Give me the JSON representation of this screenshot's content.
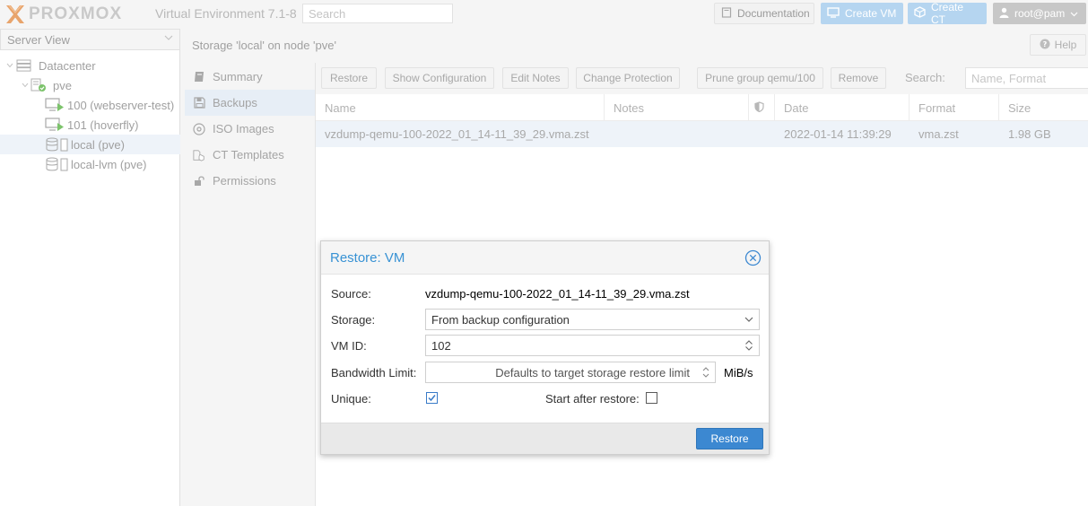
{
  "header": {
    "logo_text": "PROXMOX",
    "version": "Virtual Environment 7.1-8",
    "search_placeholder": "Search",
    "documentation_label": "Documentation",
    "create_vm_label": "Create VM",
    "create_ct_label": "Create CT",
    "user_label": "root@pam"
  },
  "tree": {
    "view_selector": "Server View",
    "nodes": [
      {
        "label": "Datacenter",
        "icon": "datacenter-icon"
      },
      {
        "label": "pve",
        "icon": "node-icon"
      },
      {
        "label": "100 (webserver-test)",
        "icon": "vm-running-icon"
      },
      {
        "label": "101 (hoverfly)",
        "icon": "vm-running-icon"
      },
      {
        "label": "local (pve)",
        "icon": "storage-icon",
        "selected": true
      },
      {
        "label": "local-lvm (pve)",
        "icon": "storage-icon"
      }
    ]
  },
  "content": {
    "title": "Storage 'local' on node 'pve'",
    "help_label": "Help"
  },
  "subnav": {
    "items": [
      {
        "label": "Summary",
        "icon": "book-icon"
      },
      {
        "label": "Backups",
        "icon": "floppy-icon",
        "active": true
      },
      {
        "label": "ISO Images",
        "icon": "disc-icon"
      },
      {
        "label": "CT Templates",
        "icon": "template-icon"
      },
      {
        "label": "Permissions",
        "icon": "unlock-icon"
      }
    ]
  },
  "toolbar": {
    "restore": "Restore",
    "show_configuration": "Show Configuration",
    "edit_notes": "Edit Notes",
    "change_protection": "Change Protection",
    "prune_group": "Prune group qemu/100",
    "remove": "Remove",
    "search_label": "Search:",
    "search_placeholder": "Name, Format"
  },
  "grid": {
    "columns": [
      "Name",
      "Notes",
      "",
      "Date",
      "Format",
      "Size"
    ],
    "rows": [
      {
        "name": "vzdump-qemu-100-2022_01_14-11_39_29.vma.zst",
        "notes": "",
        "protected": "",
        "date": "2022-01-14 11:39:29",
        "format": "vma.zst",
        "size": "1.98 GB"
      }
    ]
  },
  "dialog": {
    "title": "Restore: VM",
    "source_label": "Source:",
    "source_value": "vzdump-qemu-100-2022_01_14-11_39_29.vma.zst",
    "storage_label": "Storage:",
    "storage_value": "From backup configuration",
    "vmid_label": "VM ID:",
    "vmid_value": "102",
    "bandwidth_label": "Bandwidth Limit:",
    "bandwidth_placeholder": "Defaults to target storage restore limit",
    "bandwidth_unit": "MiB/s",
    "unique_label": "Unique:",
    "unique_checked": true,
    "start_label": "Start after restore:",
    "start_checked": false,
    "restore_button": "Restore"
  },
  "colors": {
    "accent": "#3c88d1",
    "title_blue": "#3892d4",
    "selection": "#eef3f9"
  }
}
